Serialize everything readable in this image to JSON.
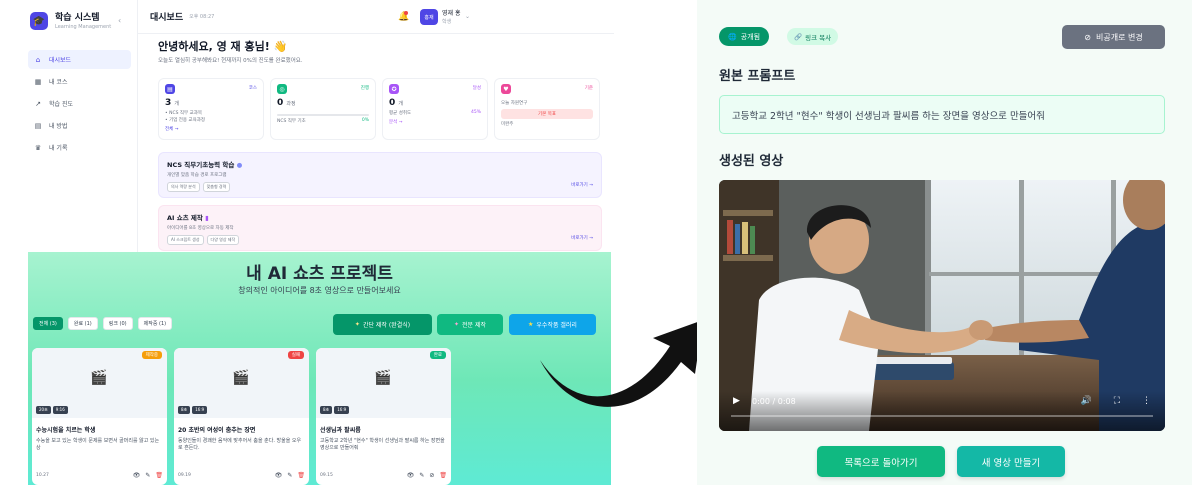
{
  "dashboard": {
    "brand": {
      "name": "학습 시스템",
      "sub": "Learning Management",
      "logo_icon": "graduation-cap-icon"
    },
    "nav": [
      {
        "label": "대시보드",
        "icon": "home-icon",
        "active": true
      },
      {
        "label": "내 코스",
        "icon": "grid-icon",
        "active": false
      },
      {
        "label": "학습 진도",
        "icon": "chart-icon",
        "active": false
      },
      {
        "label": "내 방법",
        "icon": "book-icon",
        "active": false
      },
      {
        "label": "내 기록",
        "icon": "trophy-icon",
        "active": false
      }
    ],
    "topbar": {
      "title": "대시보드",
      "time": "오후 08:27",
      "user_avatar": "홍재",
      "user_name": "영재 홍",
      "user_role": "학생"
    },
    "greeting": "안녕하세요, 영 재 홍님! 👋",
    "greeting_sub": "오늘도 열심히 공부해봐요! 현재까지 0%의 진도를 완료했어요.",
    "stats": [
      {
        "tag": "코스",
        "value": "3",
        "unit": "개",
        "lines": [
          "• NCS 직무 교과목",
          "• 기업 전용 교육과정"
        ],
        "link": "전체 →",
        "color": "#4f46e5"
      },
      {
        "tag": "진행",
        "value": "0",
        "unit": "과정",
        "lines": [
          "NCS 직무 기초"
        ],
        "progress_label": "0%",
        "progress": 0.0,
        "color": "#10b981"
      },
      {
        "tag": "달성",
        "value": "0",
        "unit": "개",
        "lines": [
          "평균 성취도"
        ],
        "progress_label": "45%",
        "progress": 0.45,
        "link": "분석 →",
        "color": "#a855f7"
      },
      {
        "tag": "기준",
        "value": "",
        "unit": "",
        "lines": [
          "오늘 자원연구"
        ],
        "button": "기본 목표",
        "footer": "미완주",
        "color": "#ec4899"
      }
    ],
    "panels": [
      {
        "title": "NCS 직무기초능력 학습",
        "sub": "개인별 맞춤 학습 경로 프로그램",
        "chips": [
          "의사 역량 분석",
          "맞춤형 경력"
        ],
        "link": "바로가기 →"
      },
      {
        "title": "AI 쇼츠 제작",
        "sub": "아이디어를 8초 영상으로 자동 제작",
        "chips": [
          "AI 스크립트 생성",
          "다양 영상 제작"
        ],
        "link": "바로가기 →"
      }
    ]
  },
  "shorts": {
    "title": "내 AI 쇼츠 프로젝트",
    "subtitle": "창의적인 아이디어를 8초 영상으로 만들어보세요",
    "filters": [
      {
        "label": "전체 (3)",
        "active": true
      },
      {
        "label": "완료 (1)",
        "active": false
      },
      {
        "label": "링크 (0)",
        "active": false
      },
      {
        "label": "제작중 (1)",
        "active": false
      }
    ],
    "actions": [
      {
        "label": "간단 제작 (완결식)",
        "icon": "✦",
        "color": "#059669"
      },
      {
        "label": "전문 제작",
        "icon": "✦",
        "color": "#10b981"
      },
      {
        "label": "우수작품 갤러리",
        "icon": "★",
        "color": "#0ea5e9"
      }
    ],
    "cards": [
      {
        "badge": "제작중",
        "badge_color": "#f59e0b",
        "meta": [
          "20초",
          "9:16"
        ],
        "title": "수능시험을 치르는 학생",
        "desc": "수능을 보고 있는 학생이 문제를 보면서 골머리를 앓고 있는 상",
        "date": "10.27"
      },
      {
        "badge": "실패",
        "badge_color": "#ef4444",
        "meta": [
          "8초",
          "16:9"
        ],
        "title": "20 초반의 여성이 춤추는 장면",
        "desc": "동양인들이 경쾌한 음악에 맞추어서 춤을 춘다. 방울을 오우로 흔든다.",
        "date": "09.19"
      },
      {
        "badge": "완료",
        "badge_color": "#10b981",
        "meta": [
          "8초",
          "16:9"
        ],
        "title": "선생님과 팔씨름",
        "desc": "고등학교 2학년 \"현수\" 학생이 선생님과 팔씨름 하는 장면을 영상으로 만들어줘",
        "date": "09.15"
      }
    ]
  },
  "detail": {
    "visibility_label": "공개됨",
    "copy_link_label": "링크 복사",
    "make_private_label": "비공개로 변경",
    "prompt_heading": "원본 프롬프트",
    "prompt_text": "고등학교 2학년 \"현수\" 학생이 선생님과 팔씨름 하는 장면을 영상으로 만들어줘",
    "video_heading": "생성된 영상",
    "video_time": "0:00 / 0:08",
    "back_button": "목록으로 돌아가기",
    "new_video_button": "새 영상 만들기"
  },
  "colors": {
    "accent_green": "#10b981",
    "indigo": "#4f46e5",
    "teal": "#14b8a6"
  }
}
